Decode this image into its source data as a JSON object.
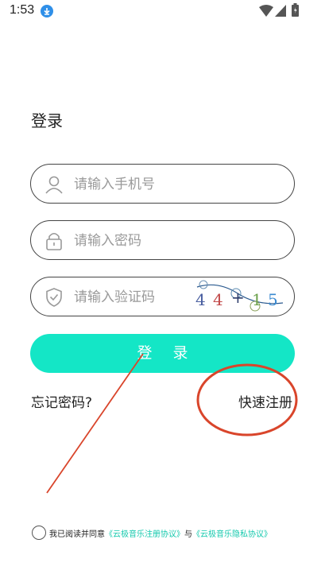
{
  "status_bar": {
    "time": "1:53",
    "icons": [
      "download-icon",
      "wifi-icon",
      "signal-icon",
      "battery-icon"
    ]
  },
  "login": {
    "title": "登录",
    "phone_placeholder": "请输入手机号",
    "password_placeholder": "请输入密码",
    "code_placeholder": "请输入验证码",
    "captcha": [
      "4",
      "4",
      "+",
      "1",
      "5"
    ],
    "submit_label": "登 录",
    "forgot_label": "忘记密码?",
    "register_label": "快速注册"
  },
  "agreement": {
    "prefix": "我已阅读并同意",
    "terms_link": "《云极音乐注册协议》",
    "conjunction": "与",
    "privacy_link": "《云极音乐隐私协议》"
  },
  "colors": {
    "accent": "#14e6c6",
    "link": "#14c9ad",
    "annotation": "#d9452b"
  }
}
